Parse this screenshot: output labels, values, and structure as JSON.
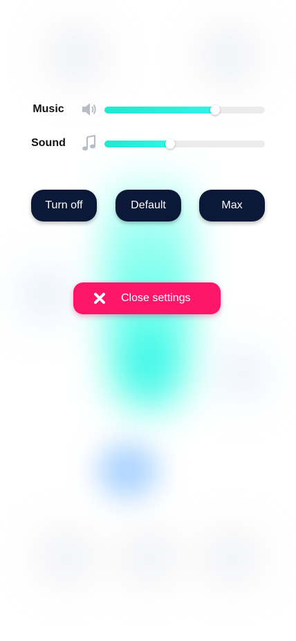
{
  "settings": {
    "music": {
      "label": "Music",
      "icon": "speaker-icon",
      "level_percent": 69
    },
    "sound": {
      "label": "Sound",
      "icon": "music-note-icon",
      "level_percent": 41
    },
    "buttons": {
      "turn_off": "Turn off",
      "default": "Default",
      "max": "Max"
    },
    "close": {
      "label": "Close settings",
      "icon": "close-icon"
    }
  },
  "colors": {
    "slider_fill": "#1fe9d0",
    "slider_track": "#ececec",
    "dark_button": "#0b1838",
    "close_button": "#fe1668",
    "text": "#111111"
  }
}
